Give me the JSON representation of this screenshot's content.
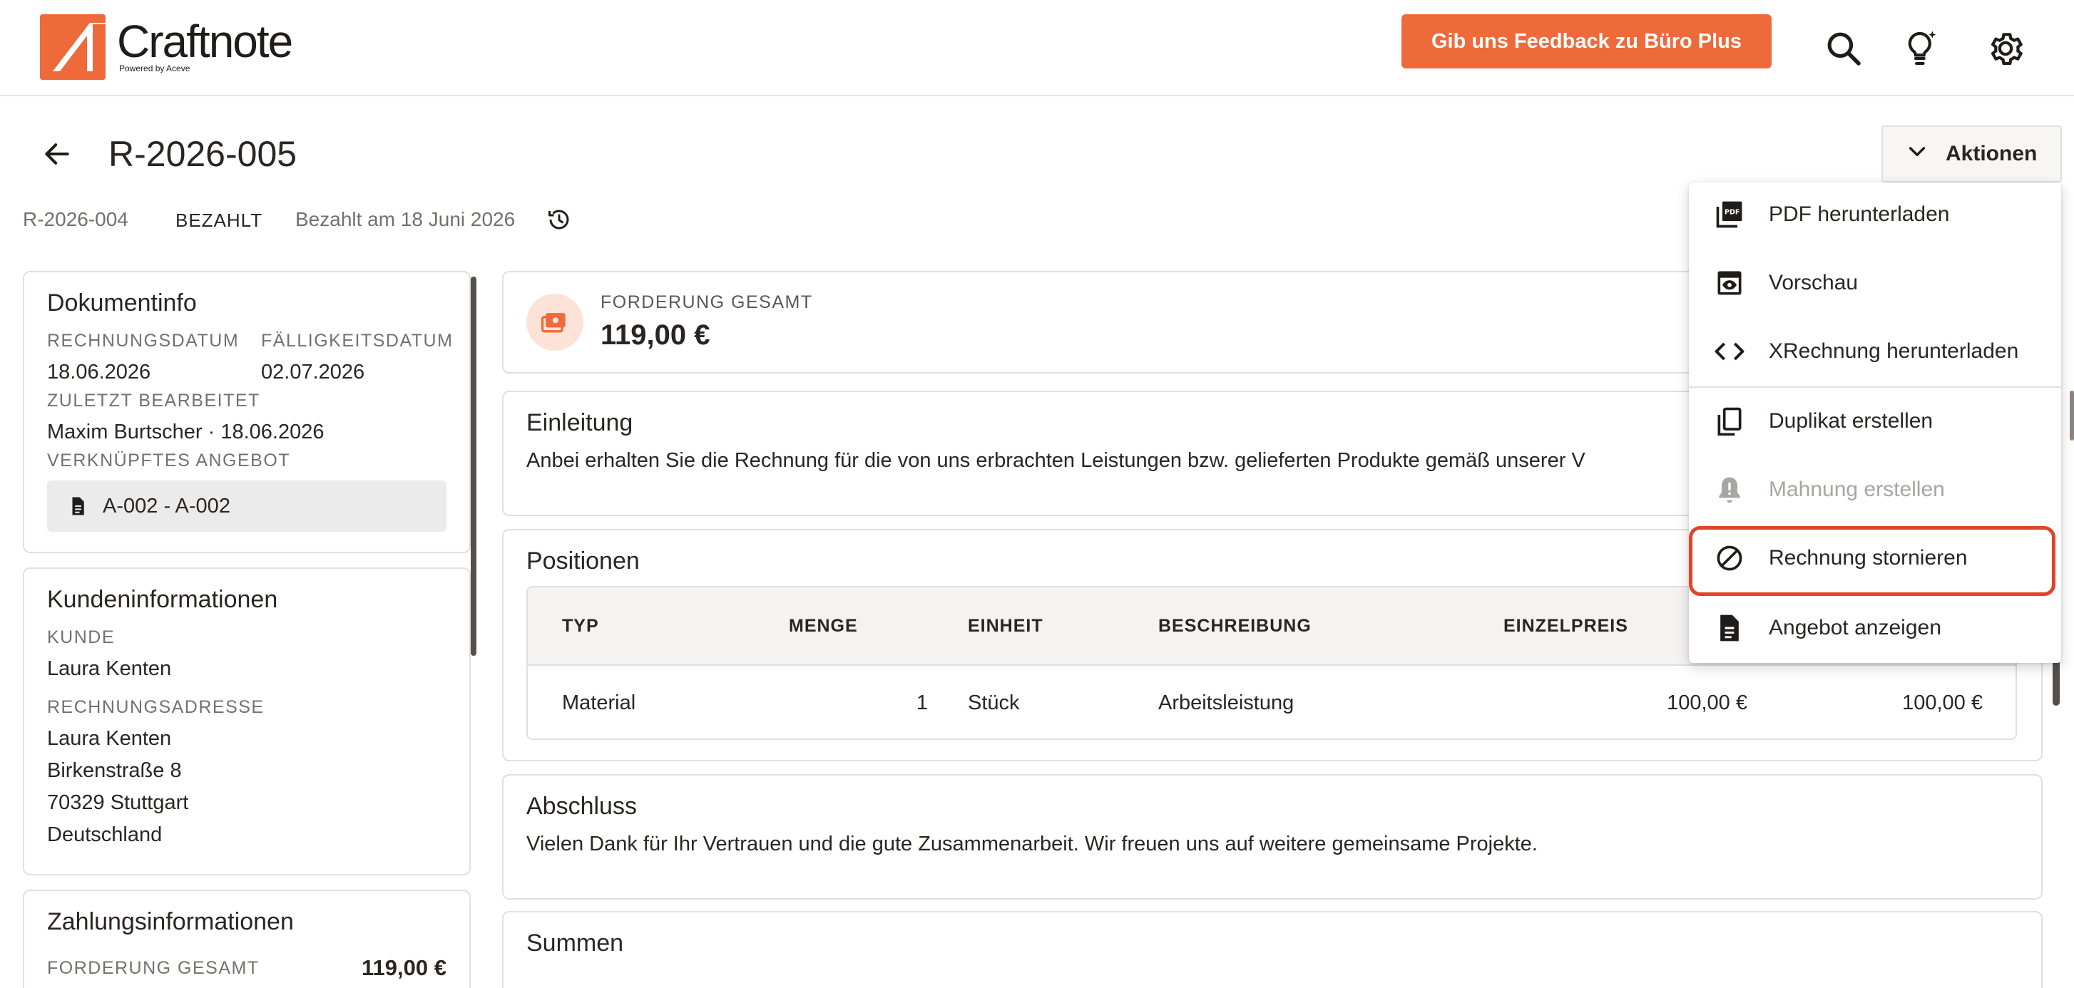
{
  "app": {
    "logo_text": "Craftnote",
    "logo_sub": "Powered by Aceve",
    "feedback_label": "Gib uns Feedback zu Büro Plus",
    "accent_color": "#ee6a3a"
  },
  "header": {
    "icons": [
      "search-icon",
      "lightbulb-sparkle-icon",
      "gear-icon"
    ]
  },
  "page": {
    "title": "R-2026-005",
    "actions_label": "Aktionen",
    "meta_ref": "R-2026-004",
    "meta_status": "BEZAHLT",
    "meta_paid": "Bezahlt am 18 Juni 2026"
  },
  "doc_info": {
    "title": "Dokumentinfo",
    "invoice_date_label": "RECHNUNGSDATUM",
    "invoice_date": "18.06.2026",
    "due_date_label": "FÄLLIGKEITSDATUM",
    "due_date": "02.07.2026",
    "last_edited_label": "ZULETZT BEARBEITET",
    "last_edited": "Maxim Burtscher · 18.06.2026",
    "linked_offer_label": "VERKNÜPFTES ANGEBOT",
    "linked_offer": "A-002 - A-002"
  },
  "customer": {
    "title": "Kundeninformationen",
    "customer_label": "KUNDE",
    "customer": "Laura Kenten",
    "address_label": "RECHNUNGSADRESSE",
    "address_name": "Laura Kenten",
    "address_street": "Birkenstraße 8",
    "address_city": "70329 Stuttgart",
    "address_country": "Deutschland"
  },
  "payment": {
    "title": "Zahlungsinformationen",
    "total_label": "FORDERUNG GESAMT",
    "total": "119,00 €"
  },
  "summary": {
    "total_label": "FORDERUNG GESAMT",
    "total": "119,00 €"
  },
  "intro": {
    "title": "Einleitung",
    "text": "Anbei erhalten Sie die Rechnung für die von uns erbrachten Leistungen bzw. gelieferten Produkte gemäß unserer V"
  },
  "positions": {
    "title": "Positionen",
    "headers": [
      "TYP",
      "MENGE",
      "EINHEIT",
      "BESCHREIBUNG",
      "EINZELPREIS"
    ],
    "rows": [
      {
        "type": "Material",
        "qty": "1",
        "unit": "Stück",
        "desc": "Arbeitsleistung",
        "unit_price": "100,00 €",
        "total": "100,00 €"
      }
    ]
  },
  "closing": {
    "title": "Abschluss",
    "text": "Vielen Dank für Ihr Vertrauen und die gute Zusammenarbeit. Wir freuen uns auf weitere gemeinsame Projekte."
  },
  "sums": {
    "title": "Summen"
  },
  "actions_menu": {
    "items": [
      {
        "label": "PDF herunterladen",
        "icon": "pdf-icon",
        "enabled": true
      },
      {
        "label": "Vorschau",
        "icon": "preview-icon",
        "enabled": true
      },
      {
        "label": "XRechnung herunterladen",
        "icon": "code-icon",
        "enabled": true
      },
      {
        "label": "Duplikat erstellen",
        "icon": "copy-icon",
        "enabled": true
      },
      {
        "label": "Mahnung erstellen",
        "icon": "bell-alert-icon",
        "enabled": false
      },
      {
        "label": "Rechnung stornieren",
        "icon": "cancel-icon",
        "enabled": true,
        "highlighted": true
      },
      {
        "label": "Angebot anzeigen",
        "icon": "document-icon",
        "enabled": true
      }
    ],
    "highlight_color": "#e2432b"
  }
}
